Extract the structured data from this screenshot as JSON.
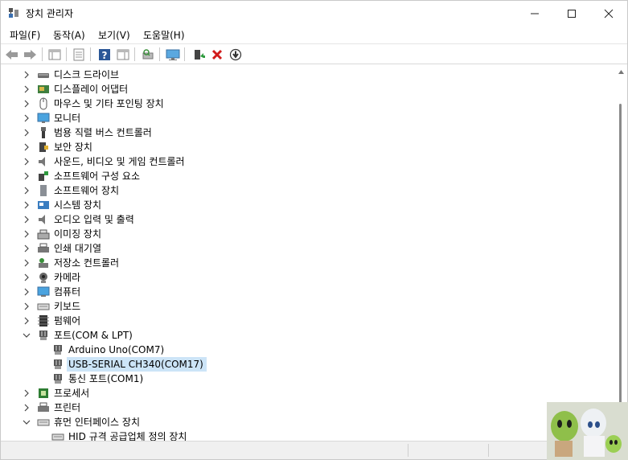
{
  "window": {
    "title": "장치 관리자",
    "minimize_glyph": "─",
    "maximize_glyph": "☐",
    "close_glyph": "✕"
  },
  "menu": [
    "파일(F)",
    "동작(A)",
    "보기(V)",
    "도움말(H)"
  ],
  "toolbar": {
    "buttons": [
      "back-icon",
      "forward-icon",
      "properties-icon",
      "properties2-icon",
      "help-icon",
      "view-icon",
      "scan-hardware-icon",
      "monitor-icon",
      "update-driver-icon",
      "uninstall-icon",
      "disable-icon"
    ]
  },
  "tree": {
    "items": [
      {
        "label": "디스크 드라이브",
        "icon": "disk-drive-icon",
        "state": "collapsed",
        "level": 1
      },
      {
        "label": "디스플레이 어댑터",
        "icon": "display-adapter-icon",
        "state": "collapsed",
        "level": 1
      },
      {
        "label": "마우스 및 기타 포인팅 장치",
        "icon": "mouse-icon",
        "state": "collapsed",
        "level": 1
      },
      {
        "label": "모니터",
        "icon": "monitor-icon",
        "state": "collapsed",
        "level": 1
      },
      {
        "label": "범용 직렬 버스 컨트롤러",
        "icon": "usb-icon",
        "state": "collapsed",
        "level": 1
      },
      {
        "label": "보안 장치",
        "icon": "security-device-icon",
        "state": "collapsed",
        "level": 1
      },
      {
        "label": "사운드, 비디오 및 게임 컨트롤러",
        "icon": "speaker-icon",
        "state": "collapsed",
        "level": 1
      },
      {
        "label": "소프트웨어 구성 요소",
        "icon": "software-component-icon",
        "state": "collapsed",
        "level": 1
      },
      {
        "label": "소프트웨어 장치",
        "icon": "software-device-icon",
        "state": "collapsed",
        "level": 1
      },
      {
        "label": "시스템 장치",
        "icon": "system-device-icon",
        "state": "collapsed",
        "level": 1
      },
      {
        "label": "오디오 입력 및 출력",
        "icon": "audio-io-icon",
        "state": "collapsed",
        "level": 1
      },
      {
        "label": "이미징 장치",
        "icon": "imaging-device-icon",
        "state": "collapsed",
        "level": 1
      },
      {
        "label": "인쇄 대기열",
        "icon": "printer-queue-icon",
        "state": "collapsed",
        "level": 1
      },
      {
        "label": "저장소 컨트롤러",
        "icon": "storage-controller-icon",
        "state": "collapsed",
        "level": 1
      },
      {
        "label": "카메라",
        "icon": "camera-icon",
        "state": "collapsed",
        "level": 1
      },
      {
        "label": "컴퓨터",
        "icon": "computer-icon",
        "state": "collapsed",
        "level": 1
      },
      {
        "label": "키보드",
        "icon": "keyboard-icon",
        "state": "collapsed",
        "level": 1
      },
      {
        "label": "펌웨어",
        "icon": "firmware-icon",
        "state": "collapsed",
        "level": 1
      },
      {
        "label": "포트(COM & LPT)",
        "icon": "port-icon",
        "state": "expanded",
        "level": 1
      },
      {
        "label": "Arduino Uno(COM7)",
        "icon": "port-icon",
        "state": "leaf",
        "level": 2
      },
      {
        "label": "USB-SERIAL CH340(COM17)",
        "icon": "port-icon",
        "state": "leaf",
        "level": 2,
        "selected": true
      },
      {
        "label": "통신 포트(COM1)",
        "icon": "port-icon",
        "state": "leaf",
        "level": 2
      },
      {
        "label": "프로세서",
        "icon": "processor-icon",
        "state": "collapsed",
        "level": 1
      },
      {
        "label": "프린터",
        "icon": "printer-icon",
        "state": "collapsed",
        "level": 1
      },
      {
        "label": "휴먼 인터페이스 장치",
        "icon": "hid-icon",
        "state": "expanded",
        "level": 1
      },
      {
        "label": "HID 규격 공급업체 정의 장치",
        "icon": "keyboard-icon",
        "state": "leaf",
        "level": 2
      }
    ]
  },
  "colors": {
    "selection": "#cce4f7",
    "uninstall_red": "#d11b1b",
    "help_blue": "#2b5797"
  }
}
